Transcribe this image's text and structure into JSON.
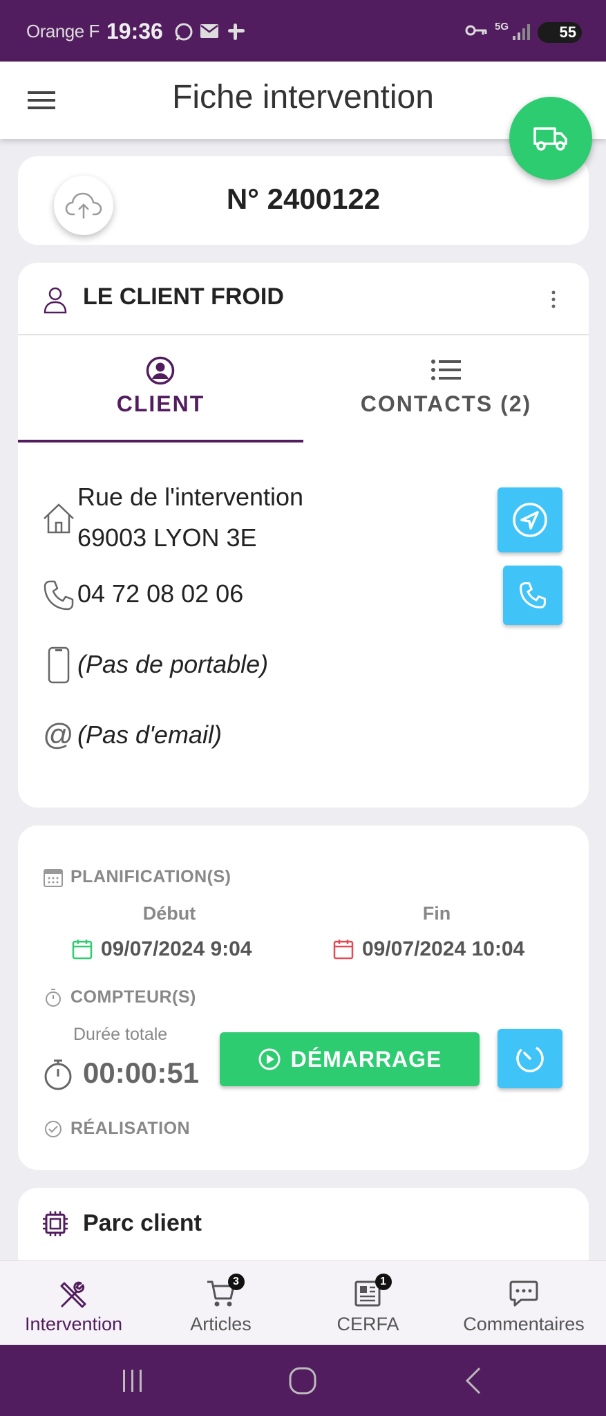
{
  "status_bar": {
    "carrier": "Orange F",
    "time": "19:36",
    "network": "5G",
    "battery": "55"
  },
  "app_bar": {
    "title": "Fiche intervention"
  },
  "intervention": {
    "number": "N° 2400122"
  },
  "client": {
    "name": "LE CLIENT FROID",
    "tabs": [
      {
        "label": "CLIENT"
      },
      {
        "label": "CONTACTS (2)"
      }
    ],
    "address_line1": "Rue de l'intervention",
    "address_line2": "69003 LYON 3E",
    "phone": "04 72 08 02 06",
    "mobile": "(Pas de portable)",
    "email": "(Pas d'email)"
  },
  "planning": {
    "section_title": "PLANIFICATION(S)",
    "start_label": "Début",
    "end_label": "Fin",
    "start_value": "09/07/2024 9:04",
    "end_value": "09/07/2024 10:04",
    "counter_title": "COMPTEUR(S)",
    "duration_label": "Durée totale",
    "duration_value": "00:00:51",
    "start_button": "DÉMARRAGE",
    "realisation_title": "RÉALISATION"
  },
  "parc": {
    "title": "Parc client"
  },
  "bottom_nav": [
    {
      "label": "Intervention",
      "badge": ""
    },
    {
      "label": "Articles",
      "badge": "3"
    },
    {
      "label": "CERFA",
      "badge": "1"
    },
    {
      "label": "Commentaires",
      "badge": ""
    }
  ],
  "colors": {
    "primary": "#521d5e",
    "success": "#2ecc71",
    "info": "#40c4f8"
  }
}
